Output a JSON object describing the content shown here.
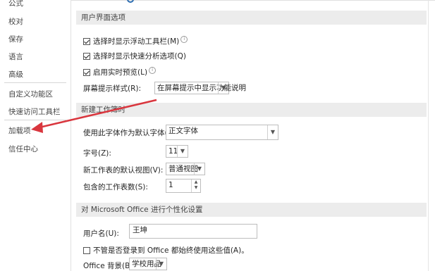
{
  "sidebar": {
    "items": [
      {
        "label": "公式"
      },
      {
        "label": "校对"
      },
      {
        "label": "保存"
      },
      {
        "label": "语言"
      },
      {
        "label": "高级"
      },
      {
        "label": "自定义功能区"
      },
      {
        "label": "快速访问工具栏"
      },
      {
        "label": "加载项"
      },
      {
        "label": "信任中心"
      }
    ]
  },
  "ui_options": {
    "header": "用户界面选项",
    "mini_toolbar": "选择时显示浮动工具栏(M)",
    "quick_analysis": "选择时显示快速分析选项(Q)",
    "live_preview": "启用实时预览(L)",
    "screentip_label": "屏幕提示样式(R):",
    "screentip_value": "在屏幕提示中显示功能说明"
  },
  "new_workbook": {
    "header": "新建工作簿时",
    "font_label": "使用此字体作为默认字体(N):",
    "font_value": "正文字体",
    "size_label": "字号(Z):",
    "size_value": "11",
    "view_label": "新工作表的默认视图(V):",
    "view_value": "普通视图",
    "sheets_label": "包含的工作表数(S):",
    "sheets_value": "1"
  },
  "personalize": {
    "header": "对 Microsoft Office 进行个性化设置",
    "username_label": "用户名(U):",
    "username_value": "王坤",
    "always_use": "不管是否登录到 Office 都始终使用这些值(A)。",
    "background_label": "Office 背景(B):",
    "background_value": "学校用品"
  },
  "annotation": {
    "color": "#d9363e"
  }
}
